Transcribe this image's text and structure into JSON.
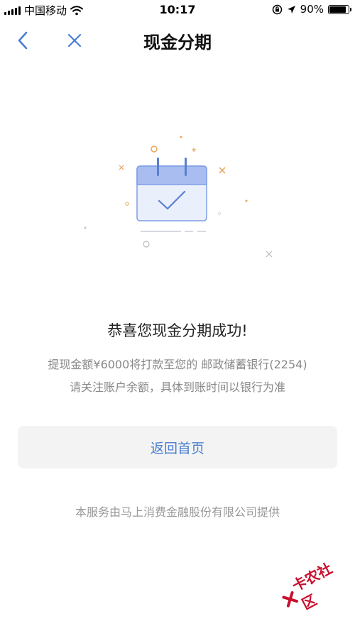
{
  "status_bar": {
    "carrier": "中国移动",
    "time": "10:17",
    "battery": "90%",
    "battery_level": 0.9
  },
  "nav": {
    "title": "现金分期",
    "back_icon": "chevron-left-icon",
    "close_icon": "close-icon"
  },
  "result": {
    "title": "恭喜您现金分期成功!",
    "line1": "提现金额¥6000将打款至您的 邮政储蓄银行(2254)",
    "line2": "请关注账户余额，具体到账时间以银行为准"
  },
  "home_button": {
    "label": "返回首页"
  },
  "footer": {
    "text": "本服务由马上消费金融股份有限公司提供"
  },
  "watermark": {
    "text": "卡农社区"
  },
  "colors": {
    "accent": "#4a7fd0",
    "calendar_header": "#a9bdf0",
    "calendar_body": "#e9effb",
    "sparkle_orange": "#e8a55a",
    "watermark": "#c8102e"
  }
}
